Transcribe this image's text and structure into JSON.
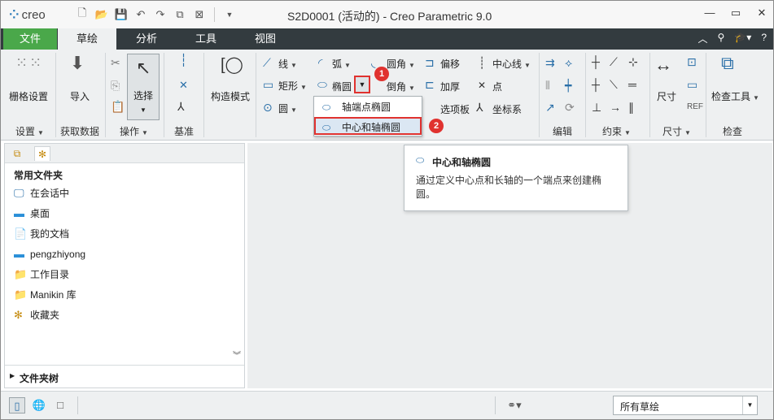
{
  "app": {
    "logo": "creo",
    "title": "S2D0001 (活动的) - Creo Parametric 9.0"
  },
  "tabs": [
    "文件",
    "草绘",
    "分析",
    "工具",
    "视图"
  ],
  "ribbon": {
    "setup": {
      "grid": "栅格设置",
      "group": "设置"
    },
    "data": {
      "import": "导入",
      "group": "获取数据"
    },
    "ops": {
      "select": "选择",
      "group": "操作"
    },
    "datum": {
      "group": "基准"
    },
    "construct": {
      "label": "构造模式"
    },
    "sketch": {
      "line": "线",
      "rect": "矩形",
      "circle": "圆",
      "arc": "弧",
      "ellipse": "椭圆",
      "fillet": "圆角",
      "chamfer": "倒角",
      "offset": "偏移",
      "thicken": "加厚",
      "palette": "选项板",
      "centerline": "中心线",
      "point": "点",
      "coordsys": "坐标系"
    },
    "editing": {
      "group": "编辑"
    },
    "constrain": {
      "group": "约束"
    },
    "dimension": {
      "label": "尺寸",
      "group": "尺寸"
    },
    "inspect": {
      "label": "检查工具",
      "group": "检查"
    }
  },
  "ellipse_menu": {
    "items": [
      "轴端点椭圆",
      "中心和轴椭圆"
    ]
  },
  "badges": {
    "one": "1",
    "two": "2"
  },
  "tooltip": {
    "title": "中心和轴椭圆",
    "body": "通过定义中心点和长轴的一个端点来创建椭圆。"
  },
  "navigator": {
    "heading": "常用文件夹",
    "items": [
      "在会话中",
      "桌面",
      "我的文档",
      "pengzhiyong",
      "工作目录",
      "Manikin 库",
      "收藏夹"
    ],
    "tree": "文件夹树"
  },
  "status": {
    "filter": "所有草绘"
  }
}
